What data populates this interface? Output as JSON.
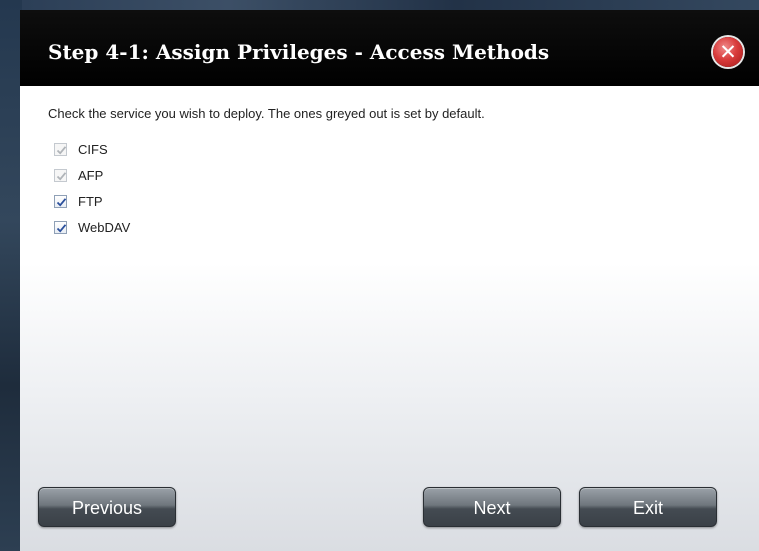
{
  "dialog": {
    "title": "Step 4-1: Assign Privileges - Access Methods",
    "close_icon": "close-icon",
    "instruction": "Check the service you wish to deploy. The ones greyed out is set by default.",
    "services": [
      {
        "label": "CIFS",
        "checked": true,
        "disabled": true
      },
      {
        "label": "AFP",
        "checked": true,
        "disabled": true
      },
      {
        "label": "FTP",
        "checked": true,
        "disabled": false
      },
      {
        "label": "WebDAV",
        "checked": true,
        "disabled": false
      }
    ],
    "buttons": {
      "previous": "Previous",
      "next": "Next",
      "exit": "Exit"
    }
  },
  "colors": {
    "titlebar": "#000000",
    "close_button": "#d93c3c",
    "check_enabled": "#2a4f9c",
    "check_disabled": "#b0b4b9"
  }
}
